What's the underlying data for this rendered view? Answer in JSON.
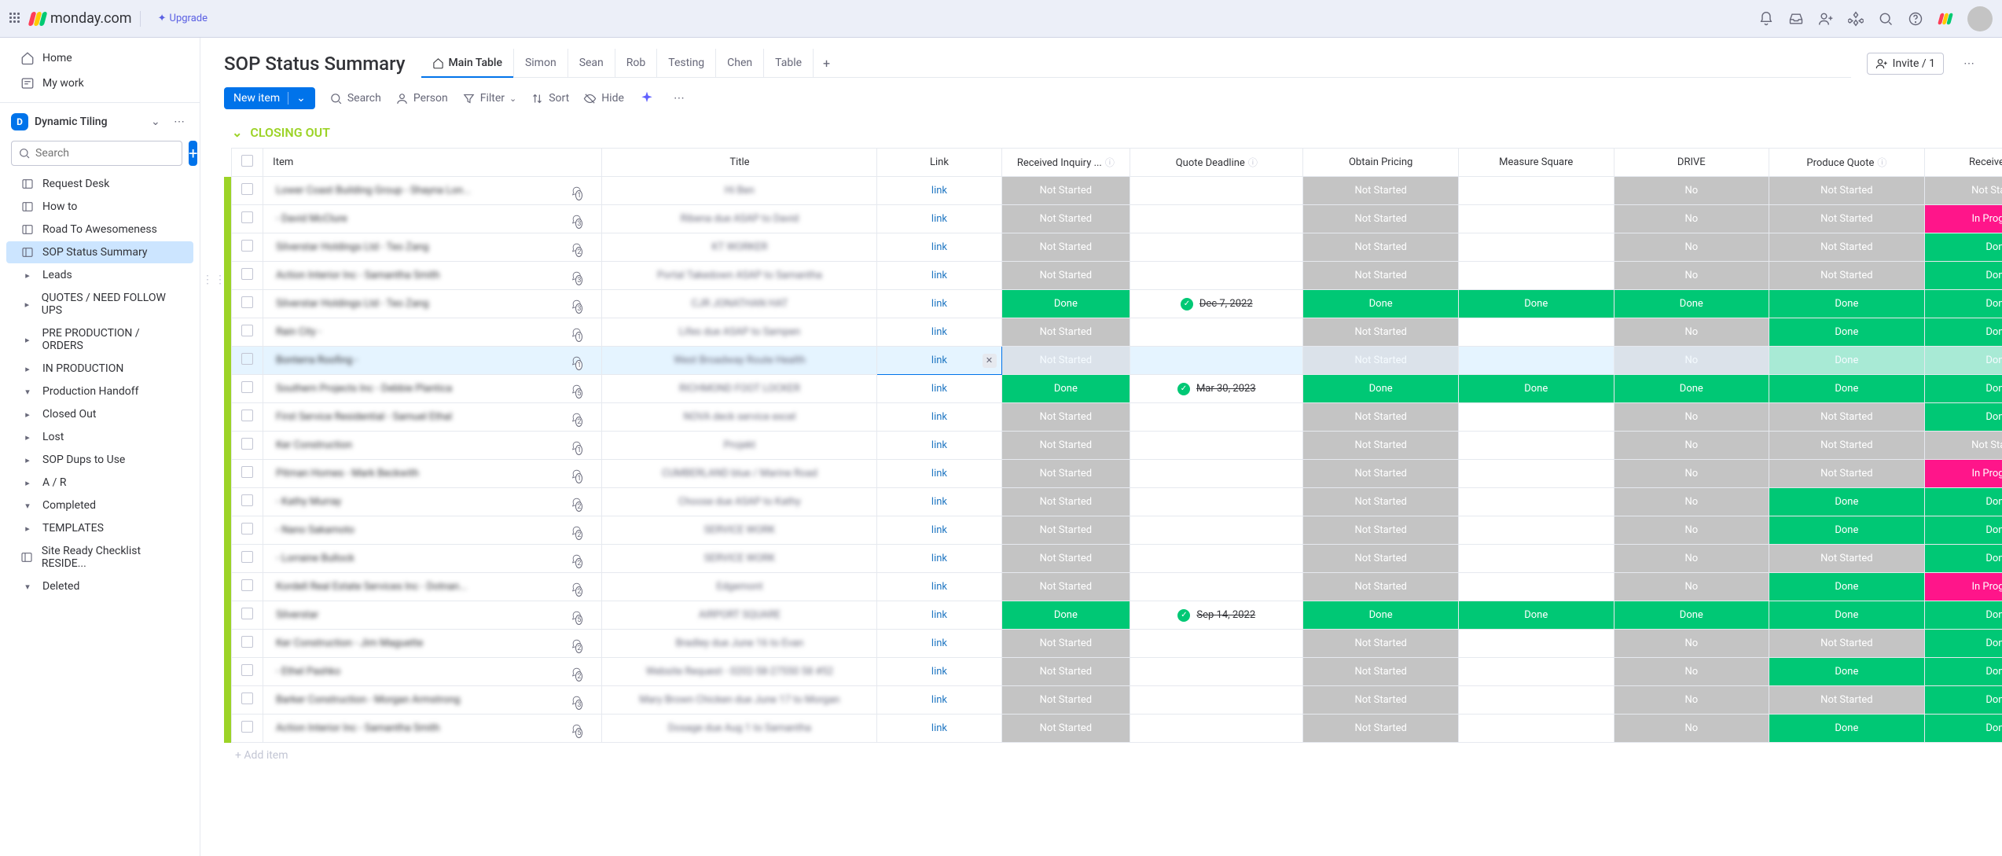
{
  "brand": "monday.com",
  "upgrade": "Upgrade",
  "topnav": {
    "home": "Home",
    "mywork": "My work"
  },
  "workspace": {
    "initial": "D",
    "name": "Dynamic Tiling"
  },
  "search_placeholder": "Search",
  "sidebar_items": [
    {
      "label": "Request Desk",
      "type": "board"
    },
    {
      "label": "How to",
      "type": "board"
    },
    {
      "label": "Road To Awesomeness",
      "type": "board"
    },
    {
      "label": "SOP Status Summary",
      "type": "board",
      "active": true
    },
    {
      "label": "Leads",
      "type": "folder"
    },
    {
      "label": "QUOTES / NEED FOLLOW UPS",
      "type": "folder"
    },
    {
      "label": "PRE PRODUCTION / ORDERS",
      "type": "folder"
    },
    {
      "label": "IN PRODUCTION",
      "type": "folder"
    },
    {
      "label": "Production Handoff",
      "type": "folder-open"
    },
    {
      "label": "Closed Out",
      "type": "folder"
    },
    {
      "label": "Lost",
      "type": "folder"
    },
    {
      "label": "SOP Dups to Use",
      "type": "folder"
    },
    {
      "label": "A / R",
      "type": "folder"
    },
    {
      "label": "Completed",
      "type": "folder-open"
    },
    {
      "label": "TEMPLATES",
      "type": "folder"
    },
    {
      "label": "Site Ready Checklist RESIDE...",
      "type": "board"
    },
    {
      "label": "Deleted",
      "type": "folder-open"
    }
  ],
  "board_title": "SOP Status Summary",
  "tabs": [
    "Main Table",
    "Simon",
    "Sean",
    "Rob",
    "Testing",
    "Chen",
    "Table"
  ],
  "active_tab": 0,
  "invite": "Invite / 1",
  "toolbar": {
    "new_item": "New item",
    "search": "Search",
    "person": "Person",
    "filter": "Filter",
    "sort": "Sort",
    "hide": "Hide"
  },
  "group_name": "CLOSING OUT",
  "columns": [
    "Item",
    "Title",
    "Link",
    "Received Inquiry ...",
    "Quote Deadline",
    "Obtain Pricing",
    "Measure Square",
    "DRIVE",
    "Produce Quote",
    "Received PO"
  ],
  "link_text": "link",
  "add_item": "+ Add item",
  "status": {
    "not_started": "Not Started",
    "done": "Done",
    "in_progress": "In Progress",
    "no": "No"
  },
  "rows": [
    {
      "item": "Lower Coast Building Group - Shayna Lon...",
      "conv": 1,
      "title": "Hi Ben",
      "ri": "ns",
      "qd": "",
      "op": "ns",
      "ms": "",
      "dr": "no",
      "pq": "ns",
      "po": "ns"
    },
    {
      "item": "- David McClure",
      "conv": 3,
      "title": "Ribena due ASAP to David",
      "ri": "ns",
      "qd": "",
      "op": "ns",
      "ms": "",
      "dr": "no",
      "pq": "ns",
      "po": "ip"
    },
    {
      "item": "Silverstar Holdings Ltd - Teo Zang",
      "conv": 2,
      "title": "KT WORKER",
      "ri": "ns",
      "qd": "",
      "op": "ns",
      "ms": "",
      "dr": "no",
      "pq": "ns",
      "po": "d"
    },
    {
      "item": "Action Interior Inc - Samantha Smith",
      "conv": 3,
      "title": "Portal Takedown ASAP to Samantha",
      "ri": "ns",
      "qd": "",
      "op": "ns",
      "ms": "",
      "dr": "no",
      "pq": "ns",
      "po": "d"
    },
    {
      "item": "Silverstar Holdings Ltd - Teo Zang",
      "conv": 3,
      "title": "CJR JONATHAN HAT",
      "ri": "d",
      "qd": "Dec 7, 2022",
      "op": "d",
      "ms": "d",
      "dr": "d",
      "pq": "d",
      "po": "d"
    },
    {
      "item": "Rain City -",
      "conv": 1,
      "title": "Lifes due ASAP to Sampen",
      "ri": "ns",
      "qd": "",
      "op": "ns",
      "ms": "",
      "dr": "no",
      "pq": "d",
      "po": "d"
    },
    {
      "item": "Bonterra Roofing -",
      "conv": 1,
      "title": "West Broadway Route Health",
      "ri": "ns",
      "qd": "",
      "op": "ns",
      "ms": "",
      "dr": "no",
      "pq": "d",
      "po": "d",
      "hover": true,
      "link_active": true
    },
    {
      "item": "Southern Projects Inc - Debbie Plantica",
      "conv": 5,
      "title": "RICHMOND FOOT LOCKER",
      "ri": "d",
      "qd": "Mar 30, 2023",
      "op": "d",
      "ms": "d",
      "dr": "d",
      "pq": "d",
      "po": "d"
    },
    {
      "item": "First Service Residential - Samuel Ethal",
      "conv": 2,
      "title": "NOVA deck service excel",
      "ri": "ns",
      "qd": "",
      "op": "ns",
      "ms": "",
      "dr": "no",
      "pq": "ns",
      "po": "d"
    },
    {
      "item": "Ker Construction",
      "conv": 1,
      "title": "Projekt",
      "ri": "ns",
      "qd": "",
      "op": "ns",
      "ms": "",
      "dr": "no",
      "pq": "ns",
      "po": "ns"
    },
    {
      "item": "Pitman Homes - Mark Beckwith",
      "conv": 1,
      "title": "CUMBERLAND blue / Marine Road",
      "ri": "ns",
      "qd": "",
      "op": "ns",
      "ms": "",
      "dr": "no",
      "pq": "ns",
      "po": "ip"
    },
    {
      "item": "- Kathy Murray",
      "conv": 2,
      "title": "Choose due ASAP to Kathy",
      "ri": "ns",
      "qd": "",
      "op": "ns",
      "ms": "",
      "dr": "no",
      "pq": "d",
      "po": "d"
    },
    {
      "item": "- Nano Sakamoto",
      "conv": 2,
      "title": "SERVICE WORK",
      "ri": "ns",
      "qd": "",
      "op": "ns",
      "ms": "",
      "dr": "no",
      "pq": "d",
      "po": "d"
    },
    {
      "item": "- Lorraine Bullock",
      "conv": 2,
      "title": "SERVICE WORK",
      "ri": "ns",
      "qd": "",
      "op": "ns",
      "ms": "",
      "dr": "no",
      "pq": "ns",
      "po": "d"
    },
    {
      "item": "Kordell Real Estate Services Inc - Dotnan...",
      "conv": 2,
      "title": "Edgemont",
      "ri": "ns",
      "qd": "",
      "op": "ns",
      "ms": "",
      "dr": "no",
      "pq": "d",
      "po": "ip"
    },
    {
      "item": "Silverstar",
      "conv": 5,
      "title": "AIRPORT SQUARE",
      "ri": "d",
      "qd": "Sep 14, 2022",
      "op": "d",
      "ms": "d",
      "dr": "d",
      "pq": "d",
      "po": "d"
    },
    {
      "item": "Ker Construction - Jim Maguette",
      "conv": 2,
      "title": "Bradley due June 16 to Evan",
      "ri": "ns",
      "qd": "",
      "op": "ns",
      "ms": "",
      "dr": "no",
      "pq": "ns",
      "po": "d"
    },
    {
      "item": "- Ethel Pashko",
      "conv": 2,
      "title": "Website Request - 0202-58-27550 58 #52",
      "ri": "ns",
      "qd": "",
      "op": "ns",
      "ms": "",
      "dr": "no",
      "pq": "d",
      "po": "d"
    },
    {
      "item": "Barker Construction - Morgan Armstrong",
      "conv": 3,
      "title": "Mary Brown Chicken due June 17 to Morgan",
      "ri": "ns",
      "qd": "",
      "op": "ns",
      "ms": "",
      "dr": "no",
      "pq": "ns",
      "po": "d"
    },
    {
      "item": "Action Interior Inc - Samantha Smith",
      "conv": 5,
      "title": "Dosage due Aug 1 to Samantha",
      "ri": "ns",
      "qd": "",
      "op": "ns",
      "ms": "",
      "dr": "no",
      "pq": "d",
      "po": "d"
    }
  ]
}
